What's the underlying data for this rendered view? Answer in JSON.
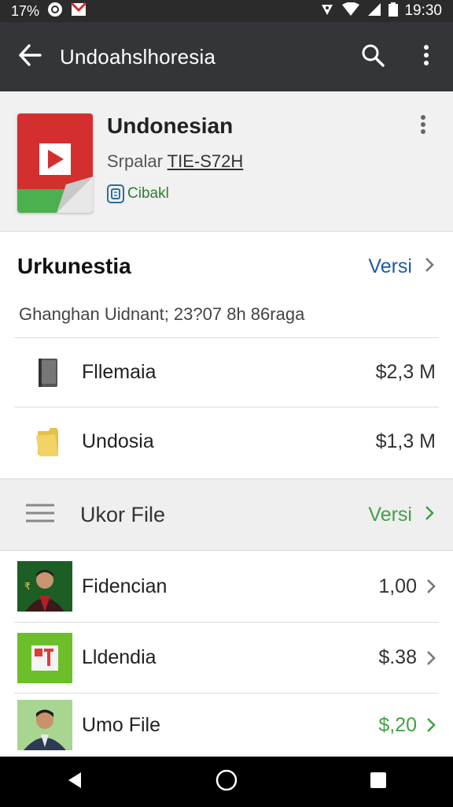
{
  "status_bar": {
    "left_text": "17%",
    "time": "19:30",
    "icons": [
      "whatsapp-icon",
      "gmail-icon",
      "nfc-icon",
      "wifi-icon",
      "signal-icon",
      "battery-icon"
    ]
  },
  "app_bar": {
    "title": "Undoahslhoresia",
    "icons": [
      "back-arrow-icon",
      "search-icon",
      "more-vert-icon"
    ]
  },
  "header": {
    "app_name": "Undonesian",
    "sub_prefix": "Srpalar",
    "sub_code": "TIE-S72H",
    "badge_label": "Cibakl",
    "icons": [
      "app-icon",
      "verified-badge-icon",
      "more-vert-icon"
    ]
  },
  "section1": {
    "title": "Urkunestia",
    "link_label": "Versi",
    "description": "Ghanghan Uidnant; 23?07 8h 86raga",
    "rows": [
      {
        "label": "Fllemaia",
        "value": "$2,3 M",
        "icon": "document-icon"
      },
      {
        "label": "Undosia",
        "value": "$1,3 M",
        "icon": "folder-icon"
      }
    ]
  },
  "section2": {
    "title": "Ukor File",
    "link_label": "Versi",
    "icon": "menu-icon"
  },
  "files": [
    {
      "label": "Fidencian",
      "value": "1,00",
      "thumb": "person-thumbnail"
    },
    {
      "label": "Lldendia",
      "value": "$.38",
      "thumb": "app-thumbnail"
    },
    {
      "label": "Umo File",
      "value": "$,20",
      "thumb": "person-thumbnail"
    }
  ],
  "colors": {
    "app_bar": "#333539",
    "link_blue": "#1e5aa8",
    "link_green": "#43a047",
    "value_green": "#43a047",
    "icon_red": "#d32f2f"
  },
  "nav_bar": {
    "icons": [
      "back-triangle-icon",
      "home-circle-icon",
      "recents-square-icon"
    ]
  }
}
